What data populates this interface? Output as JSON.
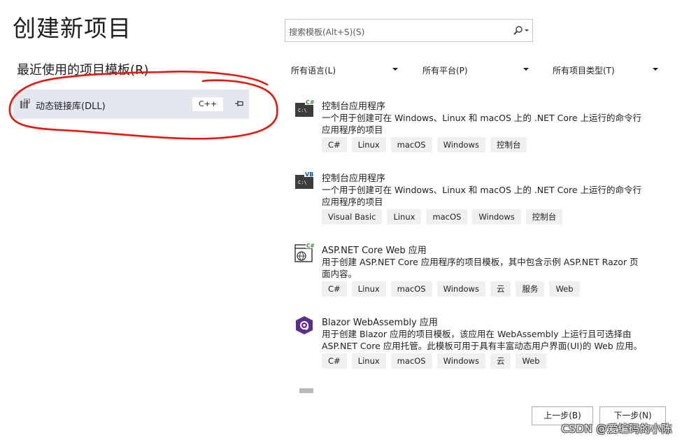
{
  "page_title": "创建新项目",
  "recent": {
    "header": "最近使用的项目模板(R)",
    "items": [
      {
        "name": "动态链接库(DLL)",
        "language": "C++",
        "icon": "dll-project-icon"
      }
    ]
  },
  "search": {
    "placeholder": "搜索模板(Alt+S)(S)"
  },
  "filters": {
    "language": "所有语言(L)",
    "platform": "所有平台(P)",
    "project_type": "所有项目类型(T)"
  },
  "templates": [
    {
      "name": "控制台应用程序",
      "description": "一个用于创建可在 Windows、Linux 和 macOS 上的 .NET Core 上运行的命令行应用程序的项目",
      "icon": "console-csharp-icon",
      "badge": "C#",
      "tags": [
        "C#",
        "Linux",
        "macOS",
        "Windows",
        "控制台"
      ]
    },
    {
      "name": "控制台应用程序",
      "description": "一个用于创建可在 Windows、Linux 和 macOS 上的 .NET Core 上运行的命令行应用程序的项目",
      "icon": "console-vb-icon",
      "badge": "VB",
      "tags": [
        "Visual Basic",
        "Linux",
        "macOS",
        "Windows",
        "控制台"
      ]
    },
    {
      "name": "ASP.NET Core Web 应用",
      "description": "用于创建 ASP.NET Core 应用程序的项目模板，其中包含示例 ASP.NET Razor 页面内容。",
      "icon": "web-app-icon",
      "badge": "C#",
      "tags": [
        "C#",
        "Linux",
        "macOS",
        "Windows",
        "云",
        "服务",
        "Web"
      ]
    },
    {
      "name": "Blazor WebAssembly 应用",
      "description": "用于创建 Blazor 应用的项目模板，该应用在 WebAssembly 上运行且可选择由 ASP.NET Core 应用托管。此模板可用于具有丰富动态用户界面(UI)的 Web 应用。",
      "icon": "blazor-icon",
      "tags": [
        "C#",
        "Linux",
        "macOS",
        "Windows",
        "云",
        "Web"
      ]
    }
  ],
  "buttons": {
    "back": "上一步(B)",
    "next": "下一步(N)"
  },
  "watermark": "CSDN @爱编码的小陈",
  "colors": {
    "selected_bg": "#e4e6f0",
    "annotation": "#e8160c",
    "csharp_badge": "#388a34",
    "vb_badge": "#00539c",
    "blazor": "#5c2d91"
  }
}
